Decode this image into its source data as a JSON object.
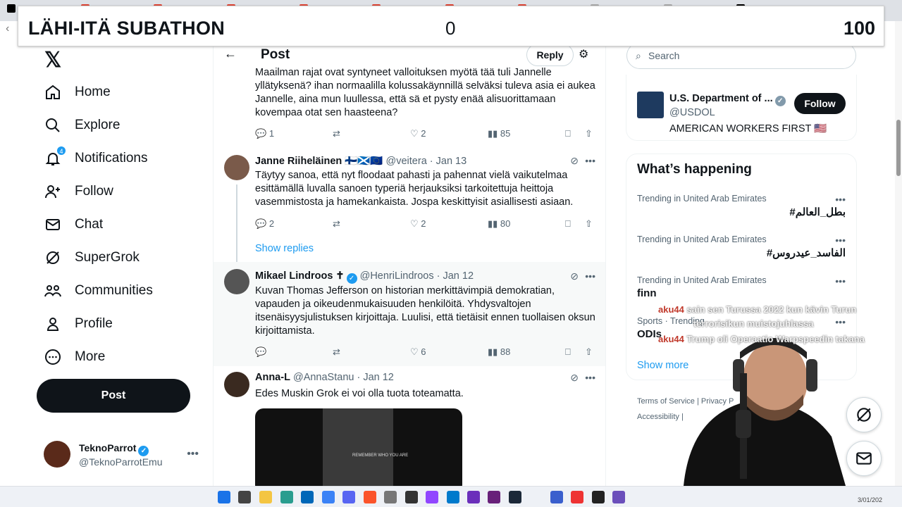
{
  "subathon": {
    "title": "LÄHI-ITÄ SUBATHON",
    "current": "0",
    "goal": "100"
  },
  "sidebar": {
    "items": [
      {
        "label": "Home"
      },
      {
        "label": "Explore"
      },
      {
        "label": "Notifications",
        "badge": "4"
      },
      {
        "label": "Follow"
      },
      {
        "label": "Chat"
      },
      {
        "label": "SuperGrok"
      },
      {
        "label": "Communities"
      },
      {
        "label": "Profile"
      },
      {
        "label": "More"
      }
    ],
    "post_label": "Post",
    "account": {
      "name": "TeknoParrot",
      "handle": "@TeknoParrotEmu"
    }
  },
  "main": {
    "header_title": "Post",
    "reply_label": "Reply",
    "show_replies": "Show replies",
    "tweets": [
      {
        "text": "Maailman rajat ovat syntyneet valloituksen myötä tää tuli Jannelle yllätyksenä? ihan normaalilla kolussakäynnillä selväksi tuleva asia ei aukea Jannelle, aina mun luullessa, että sä et pysty enää alisuorittamaan kovempaa otat sen haasteena?",
        "replies": "1",
        "likes": "2",
        "views": "85"
      },
      {
        "name": "Janne Riiheläinen 🇫🇮🏴󠁧󠁢󠁳󠁣󠁴󠁿🇪🇺",
        "handle": "@veitera · Jan 13",
        "text": "Täytyy sanoa, että nyt floodaat pahasti ja pahennat vielä vaikutelmaa esittämällä luvalla sanoen typeriä herjauksiksi tarkoitettuja heittoja vasemmistosta ja hamekankaista. Jospa keskittyisit asiallisesti asiaan.",
        "replies": "2",
        "likes": "2",
        "views": "80"
      },
      {
        "name": "Mikael Lindroos ✝",
        "handle": "@HenriLindroos · Jan 12",
        "text": "Kuvan Thomas Jefferson on historian merkittävimpiä demokratian, vapauden ja oikeudenmukaisuuden henkilöitä. Yhdysvaltojen itsenäisyysjulistuksen kirjoittaja. Luulisi, että tietäisit ennen tuollaisen oksun kirjoittamista.",
        "replies": "",
        "likes": "6",
        "views": "88"
      },
      {
        "name": "Anna-L",
        "handle": "@AnnaStanu · Jan 12",
        "text": "Edes Muskin Grok ei voi olla tuota toteamatta.",
        "media_text": "REMEMBER WHO YOU ARE"
      }
    ]
  },
  "right": {
    "search_placeholder": "Search",
    "follow_card": {
      "name": "U.S. Department of ...",
      "handle": "@USDOL",
      "bio": "AMERICAN WORKERS FIRST 🇺🇸",
      "button": "Follow"
    },
    "whats_happening": "What’s happening",
    "trends": [
      {
        "context": "Trending in United Arab Emirates",
        "name": "#بطل_العالم"
      },
      {
        "context": "Trending in United Arab Emirates",
        "name": "#الفاسد_عيدروس"
      },
      {
        "context": "Trending in United Arab Emirates",
        "name": "finn"
      },
      {
        "context": "Sports · Trending",
        "name": "ODIs"
      }
    ],
    "show_more": "Show more",
    "footer1": "Terms of Service  |  Privacy P",
    "footer2": "Accessibility  |"
  },
  "chat_overlay": [
    {
      "user": "aku44",
      "msg": "sain sen Turussa 2022 kun kävin Turun"
    },
    {
      "user": "",
      "msg": "terrorisikun muistojuhlassa"
    },
    {
      "user": "aku44",
      "msg": "Trump oli Operaatio Warpspeedin takana"
    }
  ],
  "taskbar": {
    "clock": "3/01/202"
  }
}
